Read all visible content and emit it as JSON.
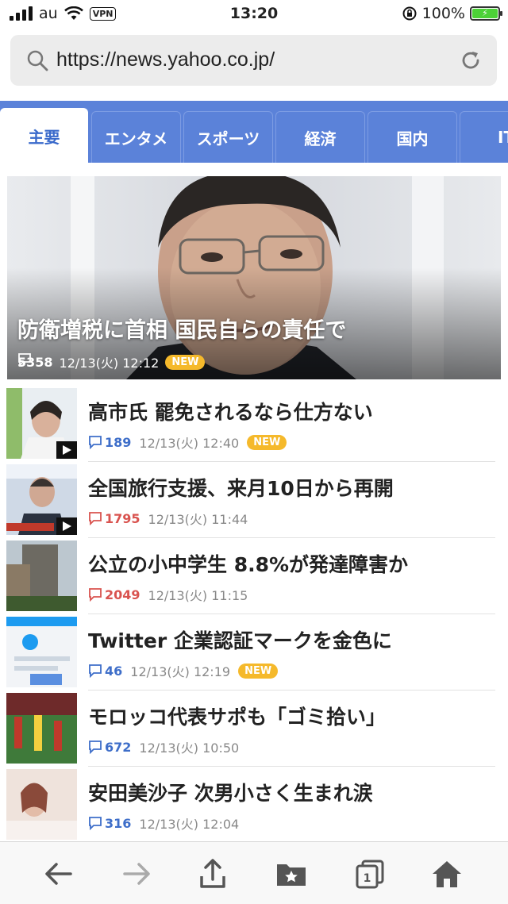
{
  "status_bar": {
    "carrier": "au",
    "vpn": "VPN",
    "time": "13:20",
    "battery": "100%"
  },
  "url_bar": {
    "url": "https://news.yahoo.co.jp/"
  },
  "tabs": [
    {
      "label": "主要",
      "active": true
    },
    {
      "label": "エンタメ"
    },
    {
      "label": "スポーツ"
    },
    {
      "label": "経済"
    },
    {
      "label": "国内"
    },
    {
      "label": "IT"
    }
  ],
  "hero": {
    "title": "防衛増税に首相 国民自らの責任で",
    "comments": "5358",
    "time": "12/13(火) 12:12",
    "badge": "NEW"
  },
  "articles": [
    {
      "title": "高市氏 罷免されるなら仕方ない",
      "comments": "189",
      "comment_color": "blue",
      "time": "12/13(火) 12:40",
      "badge": "NEW"
    },
    {
      "title": "全国旅行支援、来月10日から再開",
      "comments": "1795",
      "comment_color": "red",
      "time": "12/13(火) 11:44",
      "badge": ""
    },
    {
      "title": "公立の小中学生 8.8%が発達障害か",
      "comments": "2049",
      "comment_color": "red",
      "time": "12/13(火) 11:15",
      "badge": ""
    },
    {
      "title": "Twitter 企業認証マークを金色に",
      "comments": "46",
      "comment_color": "blue",
      "time": "12/13(火) 12:19",
      "badge": "NEW"
    },
    {
      "title": "モロッコ代表サポも「ゴミ拾い」",
      "comments": "672",
      "comment_color": "blue",
      "time": "12/13(火) 10:50",
      "badge": ""
    },
    {
      "title": "安田美沙子 次男小さく生まれ涙",
      "comments": "316",
      "comment_color": "blue",
      "time": "12/13(火) 12:04",
      "badge": ""
    }
  ],
  "toolbar": {
    "tabs_count": "1"
  },
  "icons": {
    "back": "arrow-left-icon",
    "forward": "arrow-right-icon",
    "share": "share-icon",
    "bookmarks": "bookmark-folder-icon",
    "tabs": "tabs-icon",
    "home": "home-icon"
  },
  "colors": {
    "tab_bar": "#5b82d9",
    "tab_active_text": "#3a6acb",
    "comment_blue": "#3e6ec9",
    "comment_red": "#d9534f",
    "new_badge": "#f5b92b"
  }
}
